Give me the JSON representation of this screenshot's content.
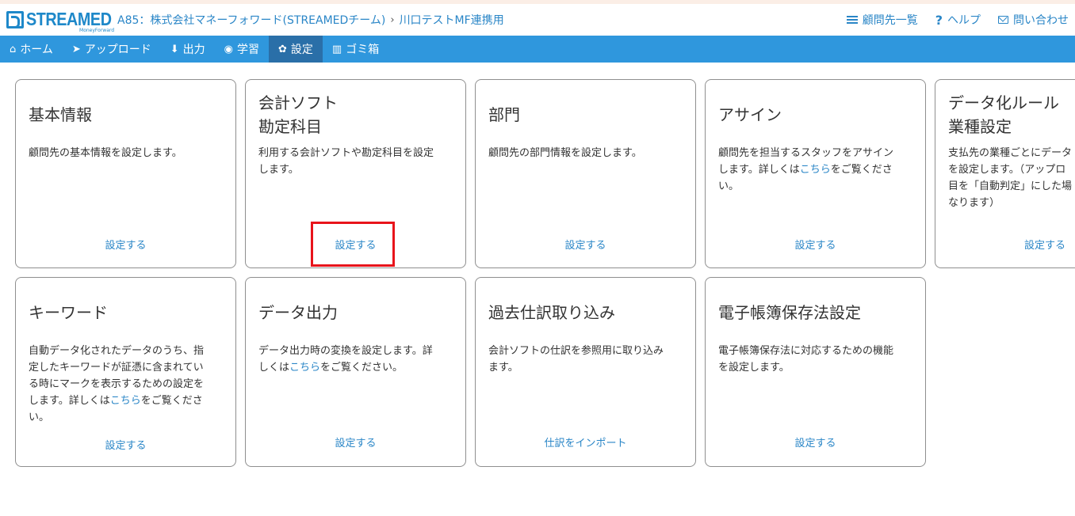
{
  "header": {
    "logo_text": "STREAMED",
    "logo_sub": "MoneyForward",
    "breadcrumb": {
      "org": "A85：株式会社マネーフォワード(STREAMEDチーム)",
      "separator": "›",
      "client": "川口テストMF連携用"
    },
    "links": [
      {
        "label": "顧問先一覧",
        "icon": "list-icon"
      },
      {
        "label": "ヘルプ",
        "icon": "question-icon"
      },
      {
        "label": "問い合わせ",
        "icon": "mail-icon"
      }
    ]
  },
  "nav": {
    "items": [
      {
        "label": "ホーム",
        "icon": "home-icon",
        "glyph": "⌂"
      },
      {
        "label": "アップロード",
        "icon": "send-icon",
        "glyph": "➤"
      },
      {
        "label": "出力",
        "icon": "download-icon",
        "glyph": "⬇"
      },
      {
        "label": "学習",
        "icon": "eye-icon",
        "glyph": "◉"
      },
      {
        "label": "設定",
        "icon": "gear-icon",
        "glyph": "✿"
      },
      {
        "label": "ゴミ箱",
        "icon": "trash-icon",
        "glyph": "▥"
      }
    ],
    "active": "設定"
  },
  "cards": [
    {
      "title1": "基本情報",
      "desc_lines": [
        "顧問先の基本情報を設定します。"
      ],
      "action": "設定する"
    },
    {
      "title1": "会計ソフト",
      "title2": "勘定科目",
      "desc_lines": [
        "利用する会計ソフトや勘定科目を設定",
        "します。"
      ],
      "action": "設定する"
    },
    {
      "title1": "部門",
      "desc_lines": [
        "顧問先の部門情報を設定します。"
      ],
      "action": "設定する"
    },
    {
      "title1": "アサイン",
      "desc_lines": [
        "顧問先を担当するスタッフをアサイン"
      ],
      "desc_pre": "します。詳しくは",
      "desc_link": "こちら",
      "desc_post": "をご覧くださ",
      "desc_last": "い。",
      "action": "設定する"
    },
    {
      "title1": "データ化ルール",
      "title2": "業種設定",
      "desc_lines": [
        "支払先の業種ごとにデータ",
        "を設定します。（アップロ",
        "目を「自動判定」にした場",
        "なります）"
      ],
      "action": "設定する"
    },
    {
      "title1": "キーワード",
      "desc_lines": [
        "自動データ化されたデータのうち、指",
        "定したキーワードが証憑に含まれてい",
        "る時にマークを表示するための設定を"
      ],
      "desc_pre": "します。詳しくは",
      "desc_link": "こちら",
      "desc_post": "をご覧くださ",
      "desc_last": "い。",
      "action": "設定する"
    },
    {
      "title1": "データ出力",
      "desc_lines": [
        "データ出力時の変換を設定します。詳"
      ],
      "desc_pre": "しくは",
      "desc_link": "こちら",
      "desc_post": "をご覧ください。",
      "action": "設定する"
    },
    {
      "title1": "過去仕訳取り込み",
      "desc_lines": [
        "会計ソフトの仕訳を参照用に取り込み",
        "ます。"
      ],
      "action": "仕訳をインポート"
    },
    {
      "title1": "電子帳簿保存法設定",
      "desc_lines": [
        "電子帳簿保存法に対応するための機能",
        "を設定します。"
      ],
      "action": "設定する"
    }
  ],
  "colors": {
    "nav_bg": "#2f97dd",
    "nav_active": "#2a6fa8",
    "link": "#2a86c7",
    "highlight": "#e8141b"
  }
}
